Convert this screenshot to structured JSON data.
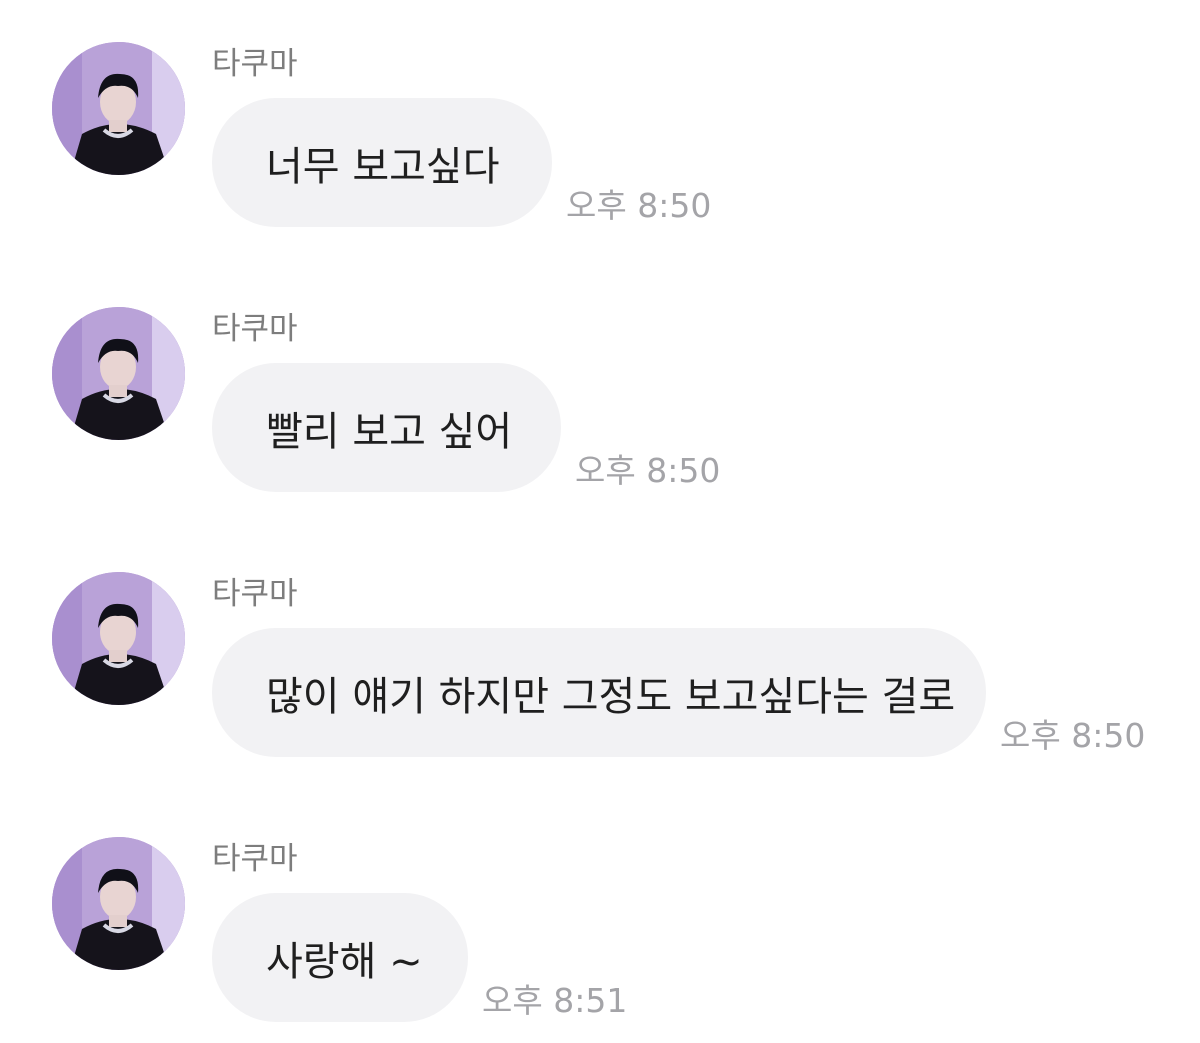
{
  "messages": [
    {
      "sender": "타쿠마",
      "text": "너무 보고싶다",
      "time": "오후 8:50"
    },
    {
      "sender": "타쿠마",
      "text": "빨리 보고 싶어",
      "time": "오후 8:50"
    },
    {
      "sender": "타쿠마",
      "text": "많이 얘기 하지만 그정도 보고싶다는 걸로",
      "time": "오후 8:50"
    },
    {
      "sender": "타쿠마",
      "text": "사랑해 ~",
      "time": "오후 8:51"
    }
  ],
  "colors": {
    "bubble": "#f2f2f4",
    "sender_text": "#7d7d7d",
    "time_text": "#a4a4a8",
    "avatar_background": "#b9a2d8"
  },
  "icons": {
    "avatar": "profile-photo"
  }
}
